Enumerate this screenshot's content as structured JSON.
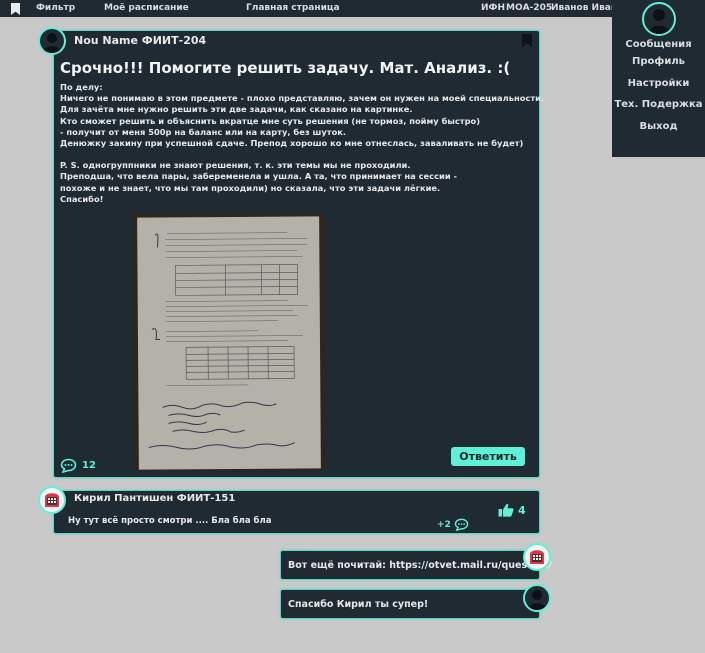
{
  "topbar": {
    "filter": "Фильтр",
    "schedule": "Моё расписание",
    "home": "Главная страница",
    "org": "ИФН",
    "group": "МОА-205",
    "user": "Иванов Иван"
  },
  "menu": {
    "items": [
      "Сообщения",
      "Профиль",
      "Настройки",
      "Тех. Подержка",
      "Выход"
    ]
  },
  "post": {
    "author": "Nou Name  ФИИТ-204",
    "title": "Срочно!!! Помогите решить задачу. Мат. Анализ. :(",
    "lines": [
      "По делу:",
      "Ничего не понимаю в этом предмете - плохо представляю, зачем он нужен на моей специальности.",
      "Для зачёта мне нужно решить эти две задачи, как сказано на картинке.",
      "Кто сможет решить и объяснить вкратце мне суть решения (не тормоз, пойму быстро)",
      " - получит от меня 500р на баланс или на карту, без шуток.",
      "Денюжку закину при успешной сдаче. Препод хорошо ко мне отнеслась, заваливать не будет)",
      "",
      "P. S. одногруппники не знают решения, т. к. эти темы мы не проходили.",
      "Преподша, что вела пары, забеременела и ушла. А та, что принимает на сессии -",
      "похоже и не знает, что мы там проходили) но сказала, что эти задачи лёгкие.",
      "Спасибо!"
    ],
    "comment_count": "12",
    "reply_label": "Ответить"
  },
  "comment": {
    "author": "Кирил Пантишен  ФИИТ-151",
    "text": "Ну тут всё просто смотри .... Бла бла бла",
    "likes": "4",
    "replies": "+2"
  },
  "replies": [
    {
      "text": "Вот ещё почитай: https://otvet.mail.ru/question/"
    },
    {
      "text": "Спасибо Кирил ты супер!"
    }
  ],
  "colors": {
    "accent": "#5ff0d8",
    "panel": "#1f2a33",
    "background": "#c9c9c9"
  }
}
